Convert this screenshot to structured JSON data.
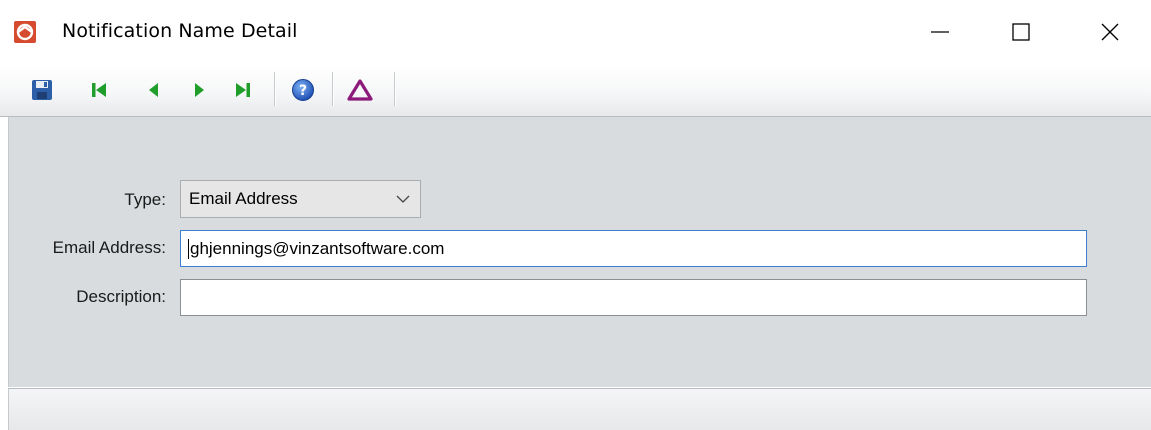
{
  "window": {
    "title": "Notification Name Detail"
  },
  "toolbar": {
    "buttons": [
      {
        "name": "save",
        "icon": "save-icon"
      },
      {
        "name": "first-record",
        "icon": "first-record-icon"
      },
      {
        "name": "previous-record",
        "icon": "previous-record-icon"
      },
      {
        "name": "next-record",
        "icon": "next-record-icon"
      },
      {
        "name": "last-record",
        "icon": "last-record-icon"
      },
      {
        "name": "help",
        "icon": "help-icon"
      },
      {
        "name": "delta",
        "icon": "delta-icon"
      }
    ]
  },
  "form": {
    "type_label": "Type:",
    "type_value": "Email Address",
    "email_label": "Email Address:",
    "email_value": "ghjennings@vinzantsoftware.com",
    "description_label": "Description:",
    "description_value": ""
  },
  "colors": {
    "nav_green": "#1f9e2c",
    "save_blue": "#2d5fa8",
    "delta_purple": "#8b1a7a",
    "help_blue": "#2a62c9",
    "focus_border": "#3c7fd1"
  }
}
